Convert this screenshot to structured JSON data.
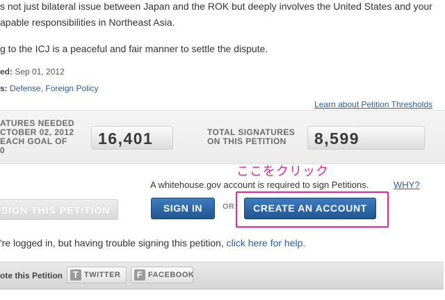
{
  "body_text": {
    "line1": "s not just bilateral issue between Japan and the ROK but deeply involves the United States and your",
    "line2": "apable responsibilities in Northeast Asia.",
    "line3": "g to the ICJ is a peaceful and fair manner to settle the dispute."
  },
  "meta": {
    "created_label": "ed:",
    "created_value": "Sep 01, 2012",
    "issues_label": "s:",
    "issues": [
      "Defense",
      "Foreign Policy"
    ],
    "issues_sep": ","
  },
  "thresholds_link": "Learn about Petition Thresholds",
  "signatures": {
    "needed_label_lines": [
      "ATURES NEEDED",
      "CTOBER 02, 2012",
      "EACH GOAL OF",
      "0"
    ],
    "needed_value": "16,401",
    "total_label_lines": [
      "TOTAL SIGNATURES",
      "ON THIS PETITION"
    ],
    "total_value": "8,599"
  },
  "annotation": {
    "text": "ここをクリック",
    "color": "#e0299a"
  },
  "account": {
    "required_text": "A whitehouse.gov account is required to sign Petitions.",
    "why_link": "WHY?",
    "sign_petition_label": "SIGN THIS PETITION",
    "sign_in_label": "SIGN IN",
    "or_label": "OR",
    "create_account_label": "CREATE AN ACCOUNT"
  },
  "help": {
    "text": "'re logged in, but having trouble signing this petition,",
    "link": "click here for help."
  },
  "share": {
    "label": "ote this Petition",
    "twitter_label": "TWITTER",
    "facebook_label": "FACEBOOK",
    "twitter_icon": "twitter-icon",
    "facebook_icon": "facebook-icon"
  },
  "colors": {
    "link": "#2a5d9f",
    "primary_button": "#2b62a3",
    "annotation": "#e0299a"
  }
}
